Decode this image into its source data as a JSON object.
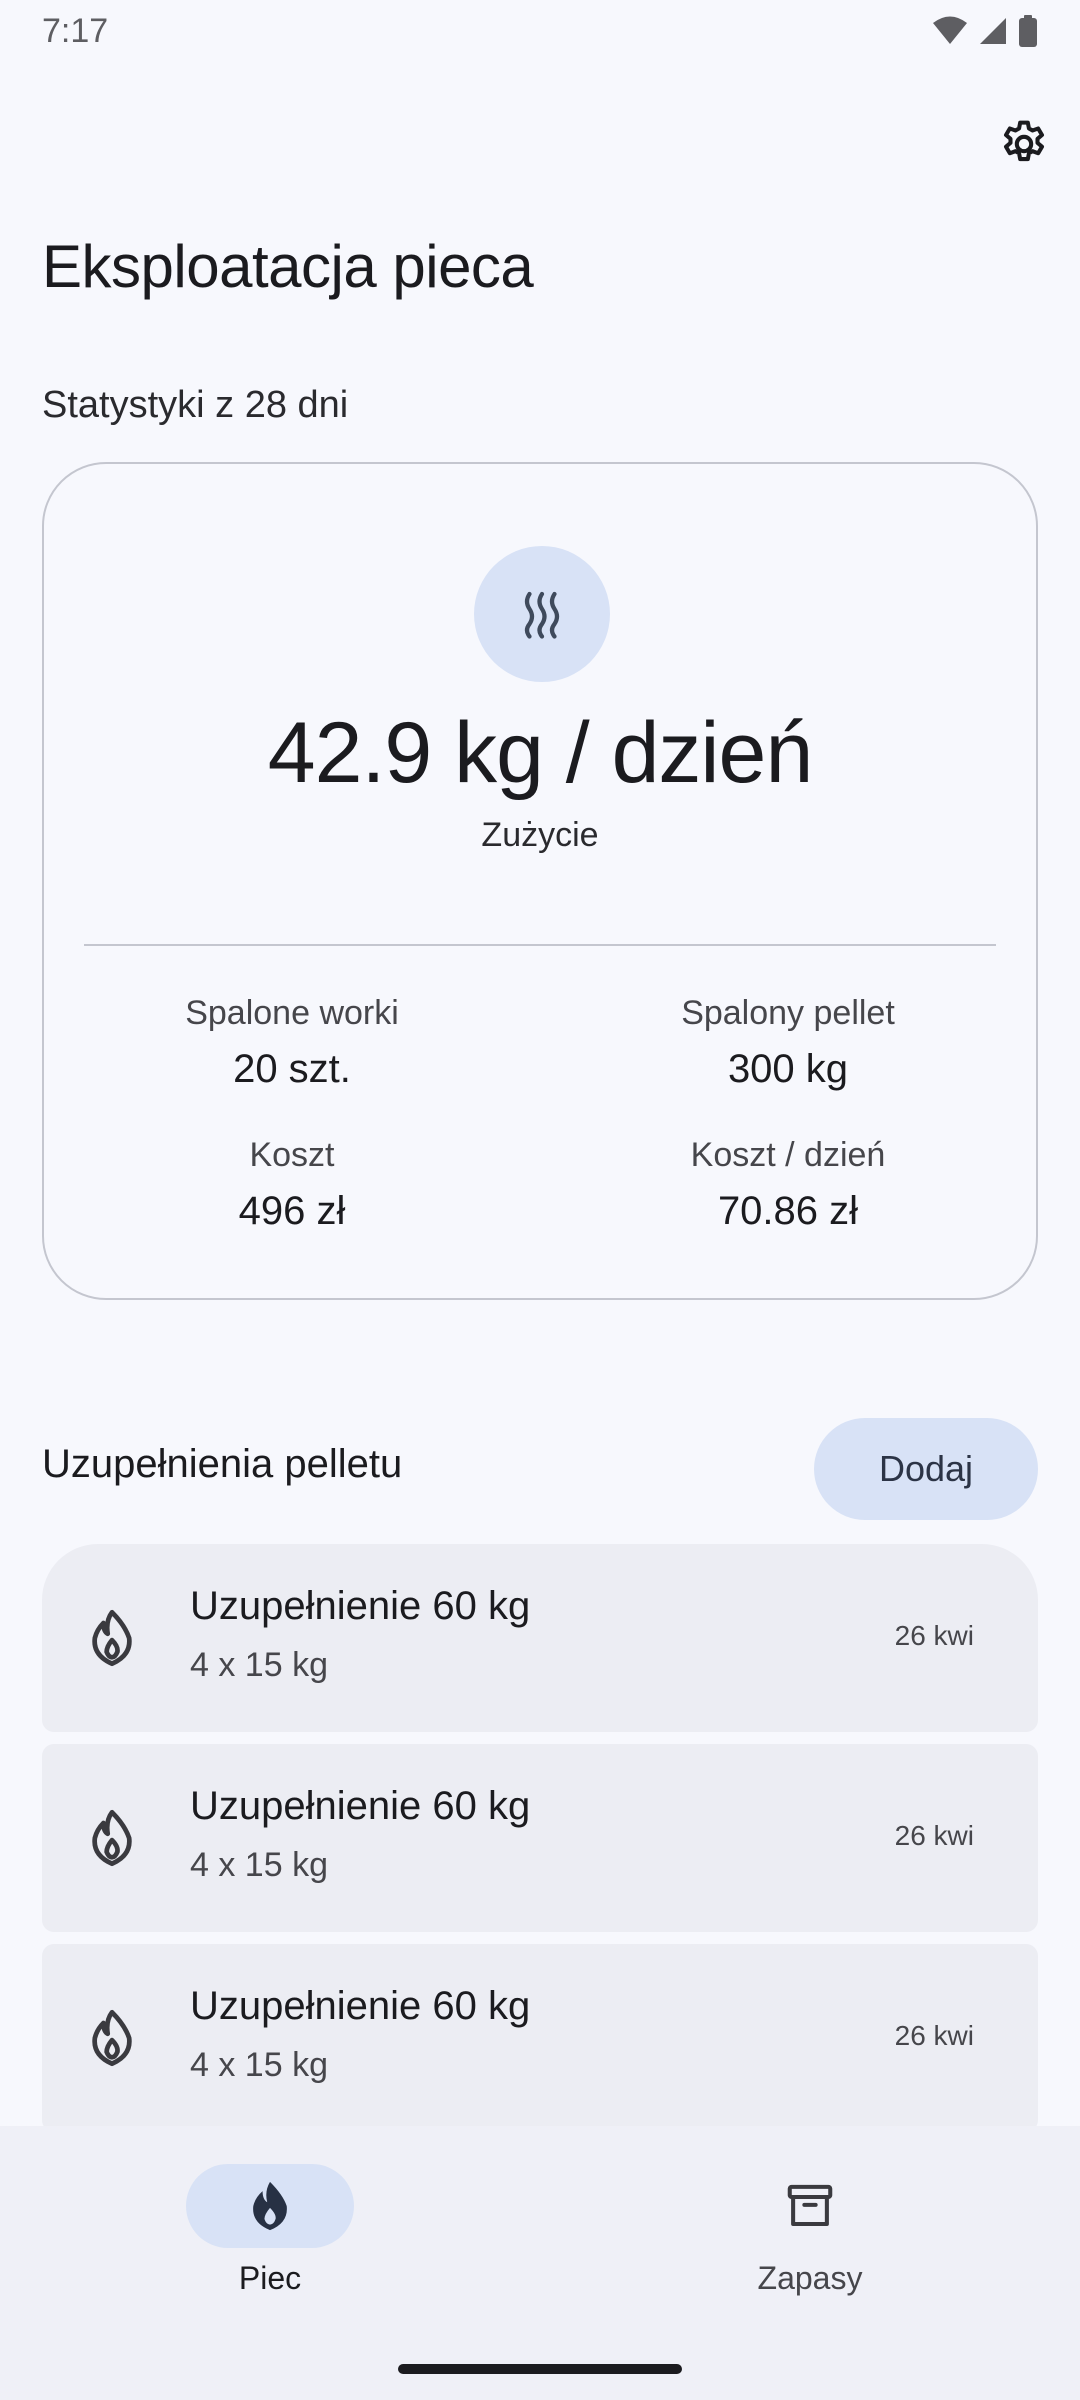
{
  "status_bar": {
    "time": "7:17",
    "icons": [
      "wifi-icon",
      "signal-icon",
      "battery-icon"
    ]
  },
  "header": {
    "title": "Eksploatacja pieca",
    "settings_icon": "gear-icon"
  },
  "stats": {
    "header": "Statystyki z 28 dni",
    "icon": "heat-waves-icon",
    "main_value": "42.9 kg / dzień",
    "main_label": "Zużycie",
    "cells": [
      {
        "label": "Spalone worki",
        "value": "20 szt."
      },
      {
        "label": "Spalony pellet",
        "value": "300 kg"
      },
      {
        "label": "Koszt",
        "value": "496 zł"
      },
      {
        "label": "Koszt / dzień",
        "value": "70.86 zł"
      }
    ]
  },
  "refills": {
    "title": "Uzupełnienia pelletu",
    "add_label": "Dodaj",
    "items": [
      {
        "title": "Uzupełnienie 60 kg",
        "subtitle": "4 x 15 kg",
        "date": "26 kwi",
        "icon": "flame-icon"
      },
      {
        "title": "Uzupełnienie 60 kg",
        "subtitle": "4 x 15 kg",
        "date": "26 kwi",
        "icon": "flame-icon"
      },
      {
        "title": "Uzupełnienie 60 kg",
        "subtitle": "4 x 15 kg",
        "date": "26 kwi",
        "icon": "flame-icon"
      }
    ]
  },
  "nav": {
    "items": [
      {
        "label": "Piec",
        "icon": "flame-icon",
        "active": true
      },
      {
        "label": "Zapasy",
        "icon": "archive-box-icon",
        "active": false
      }
    ]
  },
  "colors": {
    "background": "#f7f8fd",
    "accent_container": "#d8e2f6",
    "list_item_bg": "#ecedf3",
    "nav_bg": "#eff0f7",
    "text_primary": "#1b1b1f",
    "text_secondary": "#46464b"
  }
}
